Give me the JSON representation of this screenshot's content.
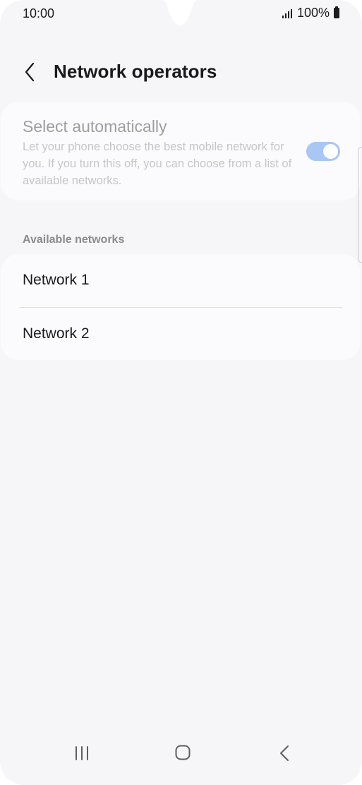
{
  "status_bar": {
    "time": "10:00",
    "battery": "100%"
  },
  "header": {
    "title": "Network operators"
  },
  "auto_select": {
    "title": "Select automatically",
    "description": "Let your phone choose the best mobile network for you. If you turn this off, you can choose from a list of available networks.",
    "enabled": true
  },
  "available_networks": {
    "label": "Available networks",
    "items": [
      {
        "label": "Network 1"
      },
      {
        "label": "Network 2"
      }
    ]
  },
  "colors": {
    "background": "#f6f6f8",
    "card": "#fbfbfd",
    "toggle_on": "#a9c6f5"
  },
  "icons": {
    "back": "chevron-left-icon",
    "nav_recents": "recents-icon",
    "nav_home": "home-icon",
    "nav_back": "back-icon"
  }
}
